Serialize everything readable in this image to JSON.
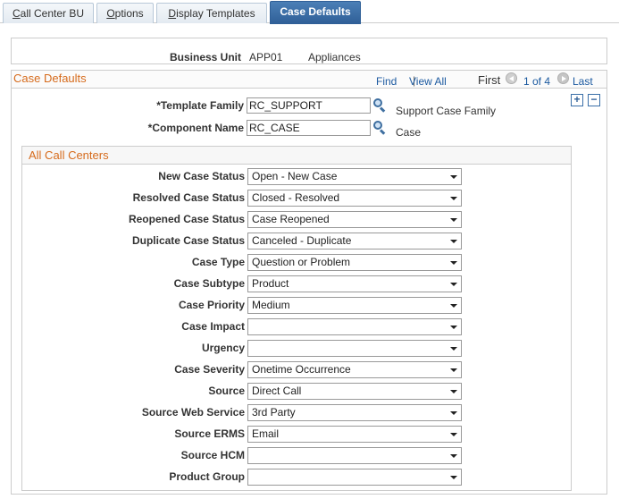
{
  "tabs": [
    {
      "label_prefix": "C",
      "label_rest": "all Center BU"
    },
    {
      "label_prefix": "O",
      "label_rest": "ptions"
    },
    {
      "label_prefix": "D",
      "label_rest": "isplay Templates"
    },
    {
      "label": "Case Defaults"
    }
  ],
  "business_unit": {
    "label": "Business Unit",
    "value": "APP01",
    "description": "Appliances"
  },
  "case_defaults": {
    "title": "Case Defaults",
    "find": "Find",
    "separator": "|",
    "view_all": "View All",
    "first": "First",
    "count": "1 of 4",
    "last": "Last",
    "add_symbol": "+",
    "remove_symbol": "−",
    "template_family": {
      "label": "*Template Family",
      "value": "RC_SUPPORT",
      "description": "Support Case Family"
    },
    "component_name": {
      "label": "*Component Name",
      "value": "RC_CASE",
      "description": "Case"
    }
  },
  "all_call_centers": {
    "title": "All Call Centers",
    "rows": [
      {
        "label": "New Case Status",
        "value": "Open - New Case"
      },
      {
        "label": "Resolved Case Status",
        "value": "Closed - Resolved"
      },
      {
        "label": "Reopened Case Status",
        "value": "Case Reopened"
      },
      {
        "label": "Duplicate Case Status",
        "value": "Canceled - Duplicate"
      },
      {
        "label": "Case Type",
        "value": "Question or Problem"
      },
      {
        "label": "Case Subtype",
        "value": "Product"
      },
      {
        "label": "Case Priority",
        "value": "Medium"
      },
      {
        "label": "Case Impact",
        "value": ""
      },
      {
        "label": "Urgency",
        "value": ""
      },
      {
        "label": "Case Severity",
        "value": "Onetime Occurrence"
      },
      {
        "label": "Source",
        "value": "Direct Call"
      },
      {
        "label": "Source Web Service",
        "value": "3rd Party"
      },
      {
        "label": "Source ERMS",
        "value": "Email"
      },
      {
        "label": "Source HCM",
        "value": ""
      },
      {
        "label": "Product Group",
        "value": ""
      }
    ]
  }
}
